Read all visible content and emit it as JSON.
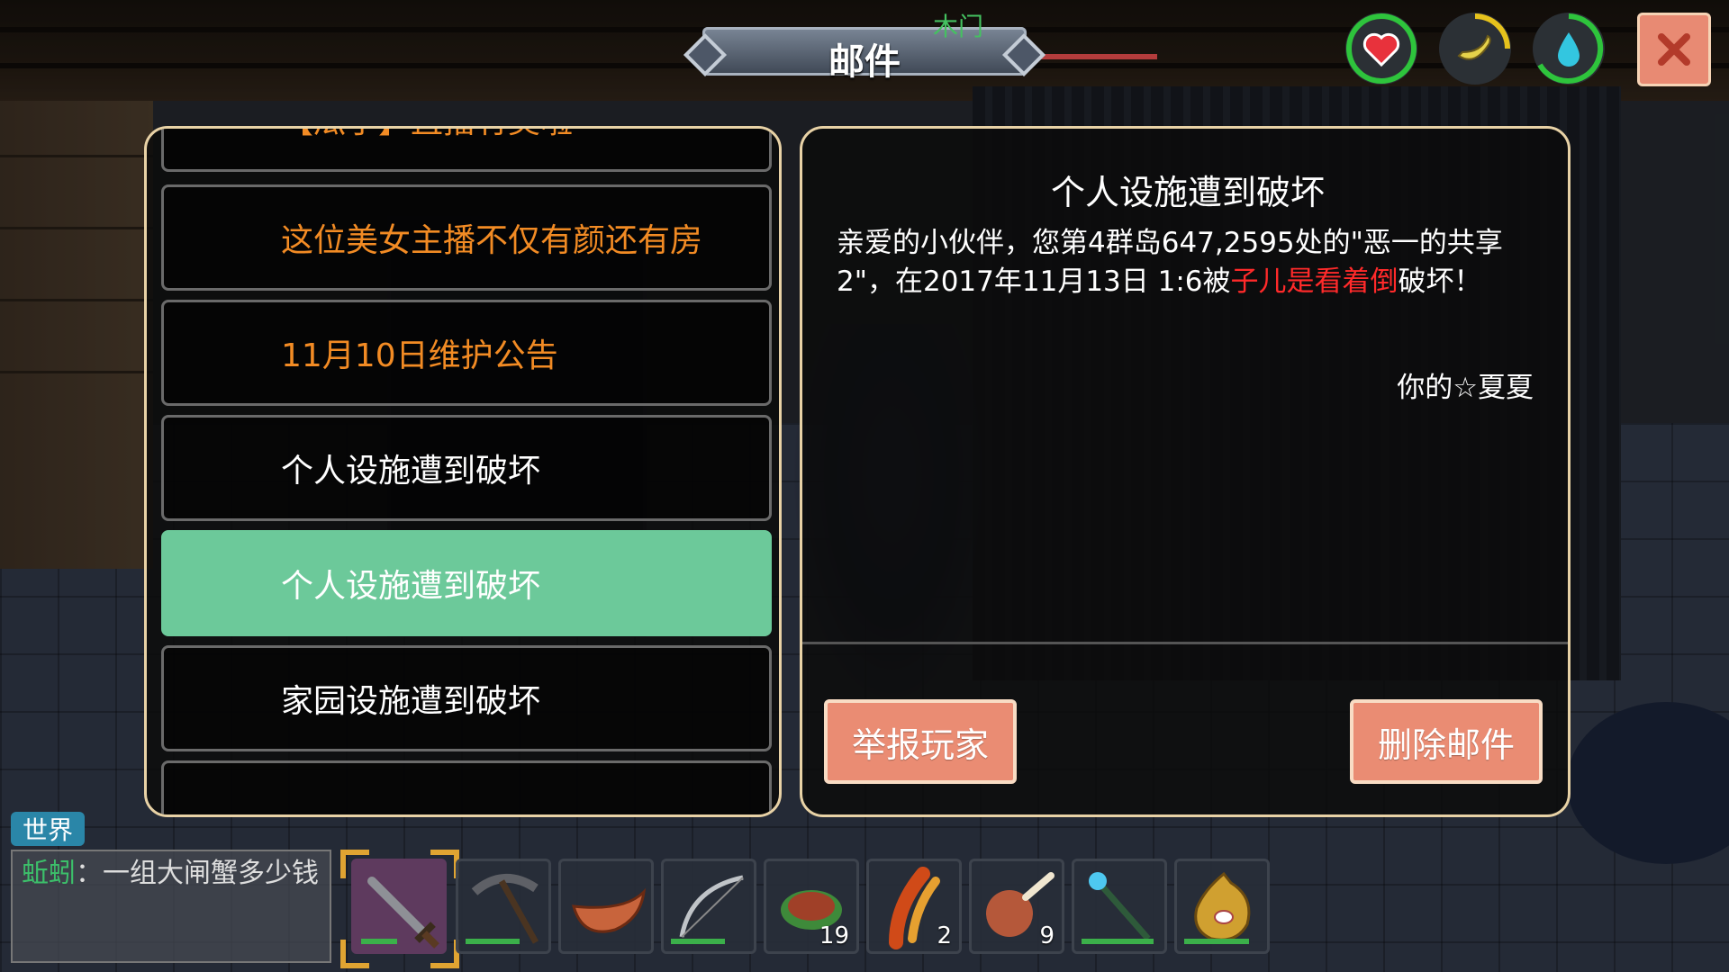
{
  "window": {
    "title": "邮件",
    "target_label": "木门"
  },
  "status_icons": [
    {
      "name": "health",
      "icon": "heart-icon",
      "color": "#e8323c",
      "ring": "#2ec43c",
      "fill_fraction": 1.0
    },
    {
      "name": "hunger",
      "icon": "banana-icon",
      "color": "#e6d24a",
      "ring": "#e6c21c",
      "fill_fraction": 0.25
    },
    {
      "name": "thirst",
      "icon": "water-drop-icon",
      "color": "#33c6e0",
      "ring": "#2ec43c",
      "fill_fraction": 0.65
    }
  ],
  "close_icon": "close-icon",
  "mail_list": [
    {
      "label": "【瓜子】直播有奖啦",
      "style": "orange"
    },
    {
      "label": "这位美女主播不仅有颜还有房",
      "style": "orange"
    },
    {
      "label": "11月10日维护公告",
      "style": "orange"
    },
    {
      "label": "个人设施遭到破坏",
      "style": "white"
    },
    {
      "label": "个人设施遭到破坏",
      "style": "selected"
    },
    {
      "label": "家园设施遭到破坏",
      "style": "white"
    },
    {
      "label": "",
      "style": "white"
    }
  ],
  "detail": {
    "title": "个人设施遭到破坏",
    "body_before": "亲爱的小伙伴，您第4群岛647,2595处的\"恶一的共享2\"，在2017年11月13日 1:6被",
    "body_highlight": "子儿是看着倒",
    "body_after": "破坏！",
    "signature": "你的☆夏夏",
    "report_button": "举报玩家",
    "delete_button": "删除邮件"
  },
  "chat": {
    "channel": "世界",
    "sender": "蚯蚓",
    "message": "：一组大闸蟹多少钱"
  },
  "hotbar": [
    {
      "icon": "sword-icon",
      "selected": true,
      "durability": 0.4,
      "count": ""
    },
    {
      "icon": "pickaxe-icon",
      "selected": false,
      "durability": 0.7,
      "count": ""
    },
    {
      "icon": "wooden-boat-icon",
      "selected": false,
      "durability": 0,
      "count": ""
    },
    {
      "icon": "bow-icon",
      "selected": false,
      "durability": 0.7,
      "count": ""
    },
    {
      "icon": "roasted-meat-icon",
      "selected": false,
      "durability": 0,
      "count": "19"
    },
    {
      "icon": "sausage-icon",
      "selected": false,
      "durability": 0,
      "count": "2"
    },
    {
      "icon": "chicken-leg-icon",
      "selected": false,
      "durability": 0,
      "count": "9"
    },
    {
      "icon": "magic-staff-icon",
      "selected": false,
      "durability": 0.85,
      "count": ""
    },
    {
      "icon": "water-flask-icon",
      "selected": false,
      "durability": 0.75,
      "count": ""
    }
  ]
}
